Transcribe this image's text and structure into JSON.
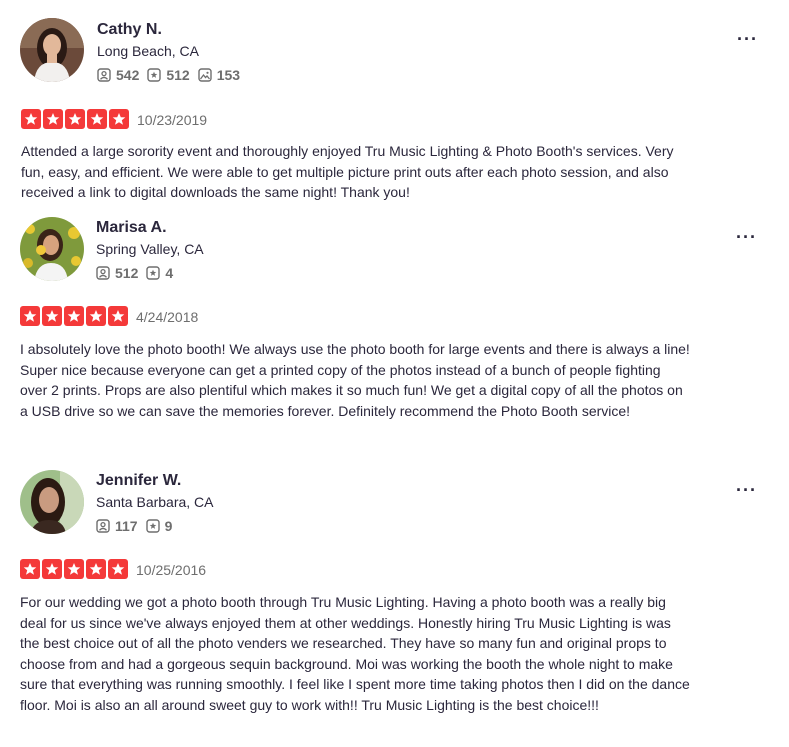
{
  "colors": {
    "star_red": "#f43939",
    "text": "#2b273c",
    "muted": "#6e6e6e"
  },
  "icons": {
    "friends": "friends-icon",
    "reviews": "review-star-icon",
    "photos": "photo-icon",
    "more": "more-options-icon",
    "star": "star-icon"
  },
  "reviews": [
    {
      "name": "Cathy N.",
      "location": "Long Beach, CA",
      "friends": "542",
      "review_count": "512",
      "photo_count": "153",
      "rating": 5,
      "date": "10/23/2019",
      "more_label": "···",
      "text": "Attended a large sorority event and thoroughly enjoyed Tru Music Lighting & Photo Booth's services. Very fun, easy, and efficient. We were able to get multiple picture print outs after each photo session, and also received a link to digital downloads the same night! Thank you!"
    },
    {
      "name": "Marisa A.",
      "location": "Spring Valley, CA",
      "friends": "512",
      "review_count": "4",
      "rating": 5,
      "date": "4/24/2018",
      "more_label": "···",
      "text": "I absolutely love the photo booth! We always use the photo booth for large events and there is always a line! Super nice because everyone can get a printed copy of the photos instead of a bunch of people fighting over 2 prints. Props are also plentiful which makes it so much fun! We get a digital copy of all the photos on a USB drive so we can save the memories forever. Definitely recommend the Photo Booth service!"
    },
    {
      "name": "Jennifer W.",
      "location": "Santa Barbara, CA",
      "friends": "117",
      "review_count": "9",
      "rating": 5,
      "date": "10/25/2016",
      "more_label": "···",
      "text": "For our wedding we got a photo booth through Tru Music Lighting. Having a photo booth was a really big deal for us since we've always enjoyed them at other weddings. Honestly hiring Tru Music Lighting is was the best choice out of all the photo venders we researched. They have so many fun and original props to choose from and had a gorgeous sequin background. Moi was working the booth the whole night to make sure that everything was running smoothly. I feel like I spent more time taking photos then I did on the dance floor. Moi is also an all around sweet guy to work with!! Tru Music Lighting is the best choice!!!"
    }
  ]
}
